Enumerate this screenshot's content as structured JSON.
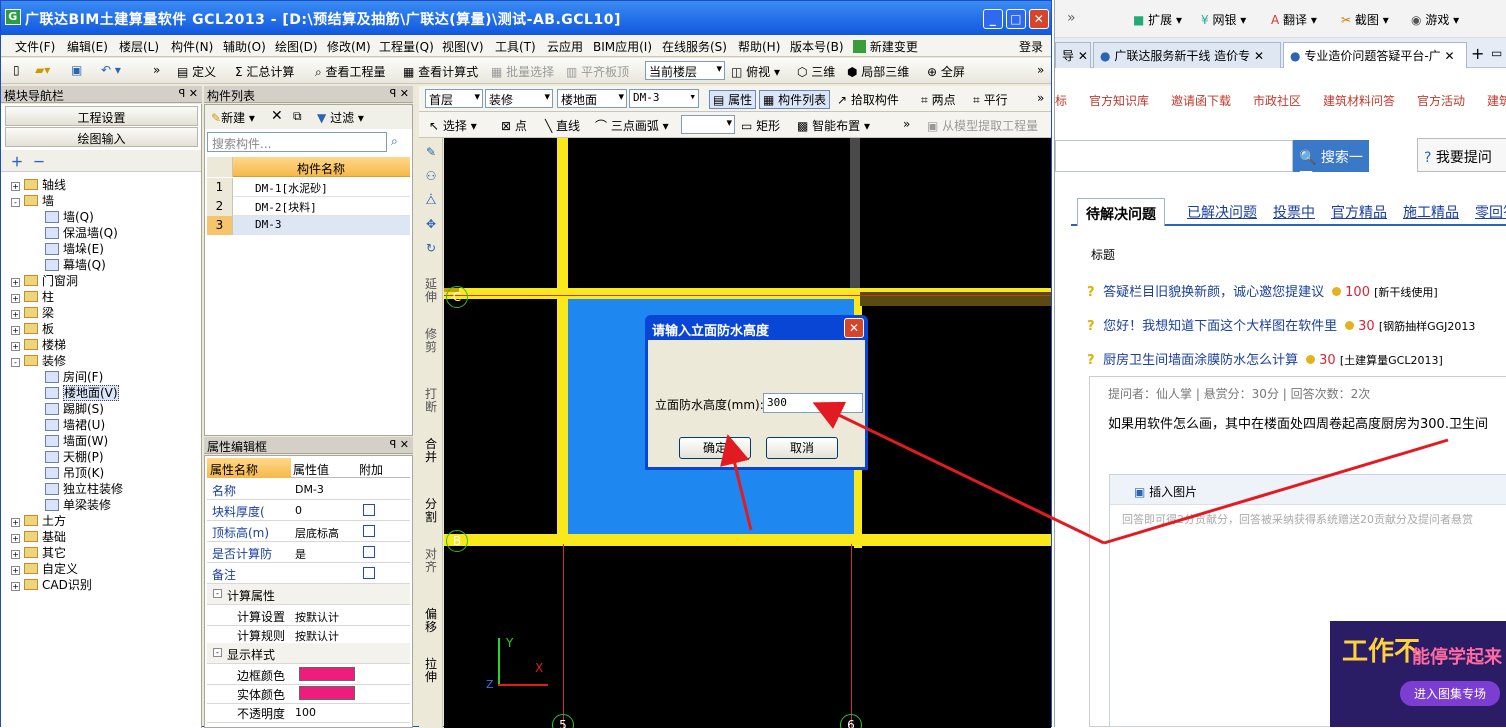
{
  "browser": {
    "top_strip": [
      "»",
      "扩展",
      "网银",
      "翻译",
      "截图",
      "游戏"
    ],
    "tabs": [
      "导",
      "广联达服务新干线 造价专",
      "专业造价问题答疑平台-广"
    ],
    "nav_links": [
      "标",
      "官方知识库",
      "邀请函下载",
      "市政社区",
      "建筑材料问答",
      "官方活动",
      "建筑"
    ],
    "search_button": "搜索一下",
    "ask_button": "我要提问",
    "question_tabs": [
      "待解决问题",
      "已解决问题",
      "投票中",
      "官方精品",
      "施工精品",
      "零回答"
    ],
    "list_header": "标题",
    "questions": [
      {
        "title": "答疑栏目旧貌换新颜，诚心邀您提建议",
        "points": "100",
        "tag": "[新干线使用]"
      },
      {
        "title": "您好！我想知道下面这个大样图在软件里",
        "points": "30",
        "tag": "[钢筋抽样GGJ2013"
      },
      {
        "title": "厨房卫生间墙面涂膜防水怎么计算",
        "points": "30",
        "tag": "[土建算量GCL2013]"
      }
    ],
    "asker_info": "提问者：仙人掌  |  悬赏分：30分  |  回答次数：2次",
    "question_body": "如果用软件怎么画，其中在楼面处四周卷起高度厨房为300.卫生间",
    "insert_image": "插入图片",
    "answer_placeholder": "回答即可得2分贡献分，回答被采纳获得系统赠送20贡献分及提问者悬赏",
    "ad_text_1": "工作不",
    "ad_text_2": "能停学起来",
    "ad_button": "进入图集专场"
  },
  "app": {
    "title": "广联达BIM土建算量软件 GCL2013 - [D:\\预结算及抽筋\\广联达(算量)\\测试-AB.GCL10]",
    "menu": [
      "文件(F)",
      "编辑(E)",
      "楼层(L)",
      "构件(N)",
      "辅助(O)",
      "绘图(D)",
      "修改(M)",
      "工程量(Q)",
      "视图(V)",
      "工具(T)",
      "云应用",
      "BIM应用(I)",
      "在线服务(S)",
      "帮助(H)",
      "版本号(B)",
      "新建变更",
      "登录"
    ],
    "toolbar1": [
      "定义",
      "Σ 汇总计算",
      "查看工程量",
      "查看计算式",
      "批量选择",
      "平齐板顶",
      "当前楼层",
      "俯视",
      "三维",
      "局部三维",
      "全屏"
    ],
    "floor_select": "首层",
    "category_select": "装修",
    "type_select": "楼地面",
    "component_select": "DM-3",
    "toolbar2_buttons": [
      "属性",
      "构件列表",
      "拾取构件",
      "两点",
      "平行"
    ],
    "draw_toolbar": [
      "选择",
      "点",
      "直线",
      "三点画弧",
      "矩形",
      "智能布置",
      "从模型提取工程量"
    ],
    "vertical_tools": [
      "延伸",
      "修剪",
      "打断",
      "合并",
      "分割",
      "对齐",
      "偏移",
      "拉伸"
    ],
    "axis_labels": [
      "C",
      "B",
      "5",
      "6"
    ]
  },
  "nav_panel": {
    "title": "模块导航栏",
    "buttons": [
      "工程设置",
      "绘图输入"
    ],
    "tree": [
      {
        "label": "轴线",
        "level": 0,
        "type": "folder",
        "exp": "+"
      },
      {
        "label": "墙",
        "level": 0,
        "type": "folder",
        "exp": "-"
      },
      {
        "label": "墙(Q)",
        "level": 1,
        "type": "item"
      },
      {
        "label": "保温墙(Q)",
        "level": 1,
        "type": "item"
      },
      {
        "label": "墙垛(E)",
        "level": 1,
        "type": "item"
      },
      {
        "label": "幕墙(Q)",
        "level": 1,
        "type": "item"
      },
      {
        "label": "门窗洞",
        "level": 0,
        "type": "folder",
        "exp": "+"
      },
      {
        "label": "柱",
        "level": 0,
        "type": "folder",
        "exp": "+"
      },
      {
        "label": "梁",
        "level": 0,
        "type": "folder",
        "exp": "+"
      },
      {
        "label": "板",
        "level": 0,
        "type": "folder",
        "exp": "+"
      },
      {
        "label": "楼梯",
        "level": 0,
        "type": "folder",
        "exp": "+"
      },
      {
        "label": "装修",
        "level": 0,
        "type": "folder",
        "exp": "-"
      },
      {
        "label": "房间(F)",
        "level": 1,
        "type": "item"
      },
      {
        "label": "楼地面(V)",
        "level": 1,
        "type": "item",
        "selected": true
      },
      {
        "label": "踢脚(S)",
        "level": 1,
        "type": "item"
      },
      {
        "label": "墙裙(U)",
        "level": 1,
        "type": "item"
      },
      {
        "label": "墙面(W)",
        "level": 1,
        "type": "item"
      },
      {
        "label": "天棚(P)",
        "level": 1,
        "type": "item"
      },
      {
        "label": "吊顶(K)",
        "level": 1,
        "type": "item"
      },
      {
        "label": "独立柱装修",
        "level": 1,
        "type": "item"
      },
      {
        "label": "单梁装修",
        "level": 1,
        "type": "item"
      },
      {
        "label": "土方",
        "level": 0,
        "type": "folder",
        "exp": "+"
      },
      {
        "label": "基础",
        "level": 0,
        "type": "folder",
        "exp": "+"
      },
      {
        "label": "其它",
        "level": 0,
        "type": "folder",
        "exp": "+"
      },
      {
        "label": "自定义",
        "level": 0,
        "type": "folder",
        "exp": "+"
      },
      {
        "label": "CAD识别",
        "level": 0,
        "type": "folder",
        "exp": "+"
      }
    ]
  },
  "component_list": {
    "title": "构件列表",
    "new_label": "新建",
    "filter_label": "过滤",
    "search_placeholder": "搜索构件...",
    "column_header": "构件名称",
    "rows": [
      {
        "num": "1",
        "name": "DM-1[水泥砂]"
      },
      {
        "num": "2",
        "name": "DM-2[块料]"
      },
      {
        "num": "3",
        "name": "DM-3"
      }
    ]
  },
  "properties": {
    "title": "属性编辑框",
    "headers": [
      "属性名称",
      "属性值",
      "附加"
    ],
    "rows": [
      {
        "name": "名称",
        "value": "DM-3",
        "check": false
      },
      {
        "name": "块料厚度(",
        "value": "0",
        "check": true
      },
      {
        "name": "顶标高(m)",
        "value": "层底标高",
        "check": true
      },
      {
        "name": "是否计算防",
        "value": "是",
        "check": true
      },
      {
        "name": "备注",
        "value": "",
        "check": true
      }
    ],
    "groups": [
      {
        "name": "计算属性",
        "rows": [
          {
            "name": "计算设置",
            "value": "按默认计"
          },
          {
            "name": "计算规则",
            "value": "按默认计"
          }
        ]
      },
      {
        "name": "显示样式",
        "rows": [
          {
            "name": "边框颜色",
            "color": "#ef1c7d"
          },
          {
            "name": "实体颜色",
            "color": "#ef1c7d"
          },
          {
            "name": "不透明度",
            "value": "100"
          }
        ]
      }
    ]
  },
  "dialog": {
    "title": "请输入立面防水高度",
    "label": "立面防水高度(mm):",
    "value": "300",
    "ok": "确定",
    "cancel": "取消"
  },
  "colors": {
    "accent": "#0a46d6",
    "floor_fill": "#1e88f0",
    "wall": "#f8e81c",
    "arrow": "#e21b22"
  }
}
